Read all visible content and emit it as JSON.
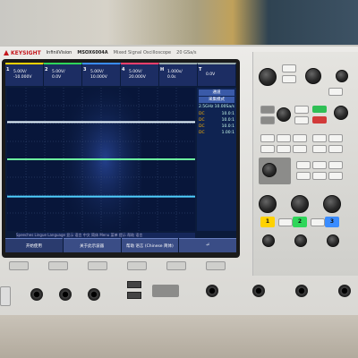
{
  "header": {
    "brand": "KEYSIGHT",
    "series": "InfiniiVision",
    "model": "MSOX6004A",
    "subtitle": "Mixed Signal Oscilloscope",
    "rate": "20 GSa/s"
  },
  "channels": [
    {
      "num": "1",
      "scale": "5.00V/",
      "offset": "-10.000V",
      "color": "#ffd200"
    },
    {
      "num": "2",
      "scale": "5.00V/",
      "offset": "0.0V",
      "color": "#2fd65a"
    },
    {
      "num": "3",
      "scale": "5.00V/",
      "offset": "10.000V",
      "color": "#3a8cff"
    },
    {
      "num": "4",
      "scale": "5.00V/",
      "offset": "20.000V",
      "color": "#ff3f6d"
    },
    {
      "num": "H",
      "scale": "1.000s/",
      "offset": "0.0s",
      "color": "#aaaaaa"
    },
    {
      "num": "T",
      "scale": "",
      "offset": "0.0V",
      "color": "#aaaaaa"
    }
  ],
  "side_panel": {
    "title": "通道",
    "mode_label": "采集模式",
    "rate_a": "2.5GHz",
    "rate_b": "10.00Sa/s",
    "rows": [
      {
        "coupling": "DC",
        "value": "10.0:1"
      },
      {
        "coupling": "DC",
        "value": "10.0:1"
      },
      {
        "coupling": "DC",
        "value": "10.0:1"
      },
      {
        "coupling": "DC",
        "value": "1.00:1"
      }
    ]
  },
  "message_line": "Speeches Lingue Language 显示 语言 中文 简体 Menu 菜单 提示 帮助 语言",
  "softkeys": [
    {
      "label": "开始使用"
    },
    {
      "label": "关于此示波器"
    },
    {
      "label": "帮助 语言 (Chinese 简体)"
    },
    {
      "label": "⏎"
    }
  ],
  "traces": {
    "levels": [
      0.24,
      0.5,
      0.76
    ]
  }
}
